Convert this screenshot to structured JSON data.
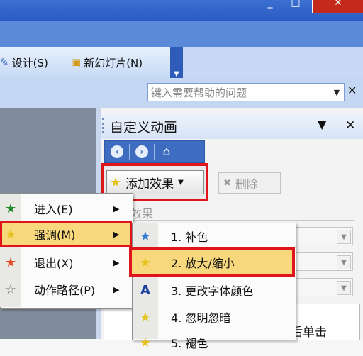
{
  "window": {
    "minimize": "_",
    "maximize": "□",
    "close": "✕"
  },
  "toolbar": {
    "design_label": "设计(S)",
    "new_slide_label": "新幻灯片(N)"
  },
  "help": {
    "placeholder": "键入需要帮助的问题"
  },
  "task_pane": {
    "title": "自定义动画",
    "add_effect_label": "添加效果",
    "delete_label": "删除",
    "effect_section": "效果",
    "list_text": "后单击"
  },
  "menu": {
    "items": [
      {
        "label": "进入(E)",
        "icon": "enter-star-icon"
      },
      {
        "label": "强调(M)",
        "icon": "emphasis-star-icon"
      },
      {
        "label": "退出(X)",
        "icon": "exit-star-icon"
      },
      {
        "label": "动作路径(P)",
        "icon": "motion-path-star-icon"
      }
    ]
  },
  "submenu": {
    "items": [
      {
        "label": "1. 补色"
      },
      {
        "label": "2. 放大/缩小"
      },
      {
        "label": "3. 更改字体颜色"
      },
      {
        "label": "4. 忽明忽暗"
      },
      {
        "label": "5. 褪色"
      }
    ]
  },
  "colors": {
    "highlight": "#f8d87c",
    "annotation": "#e0141b",
    "accent": "#3d6cc1"
  }
}
